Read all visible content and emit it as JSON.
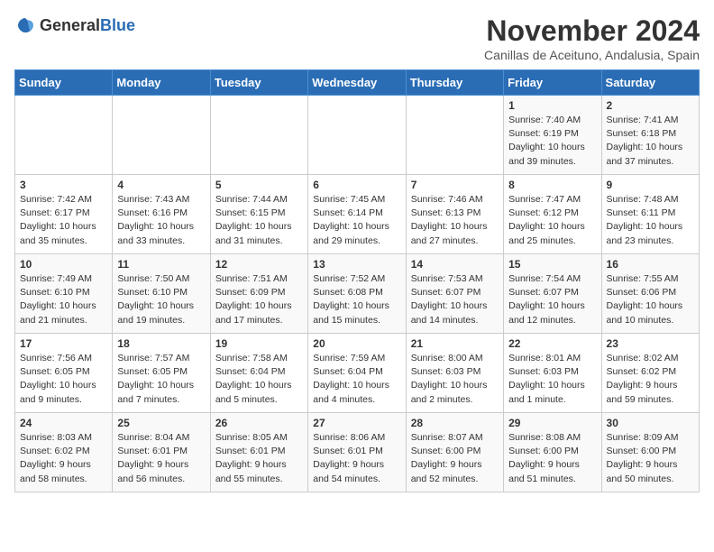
{
  "logo": {
    "text_general": "General",
    "text_blue": "Blue"
  },
  "title": "November 2024",
  "location": "Canillas de Aceituno, Andalusia, Spain",
  "weekdays": [
    "Sunday",
    "Monday",
    "Tuesday",
    "Wednesday",
    "Thursday",
    "Friday",
    "Saturday"
  ],
  "weeks": [
    [
      {
        "day": "",
        "info": ""
      },
      {
        "day": "",
        "info": ""
      },
      {
        "day": "",
        "info": ""
      },
      {
        "day": "",
        "info": ""
      },
      {
        "day": "",
        "info": ""
      },
      {
        "day": "1",
        "info": "Sunrise: 7:40 AM\nSunset: 6:19 PM\nDaylight: 10 hours\nand 39 minutes."
      },
      {
        "day": "2",
        "info": "Sunrise: 7:41 AM\nSunset: 6:18 PM\nDaylight: 10 hours\nand 37 minutes."
      }
    ],
    [
      {
        "day": "3",
        "info": "Sunrise: 7:42 AM\nSunset: 6:17 PM\nDaylight: 10 hours\nand 35 minutes."
      },
      {
        "day": "4",
        "info": "Sunrise: 7:43 AM\nSunset: 6:16 PM\nDaylight: 10 hours\nand 33 minutes."
      },
      {
        "day": "5",
        "info": "Sunrise: 7:44 AM\nSunset: 6:15 PM\nDaylight: 10 hours\nand 31 minutes."
      },
      {
        "day": "6",
        "info": "Sunrise: 7:45 AM\nSunset: 6:14 PM\nDaylight: 10 hours\nand 29 minutes."
      },
      {
        "day": "7",
        "info": "Sunrise: 7:46 AM\nSunset: 6:13 PM\nDaylight: 10 hours\nand 27 minutes."
      },
      {
        "day": "8",
        "info": "Sunrise: 7:47 AM\nSunset: 6:12 PM\nDaylight: 10 hours\nand 25 minutes."
      },
      {
        "day": "9",
        "info": "Sunrise: 7:48 AM\nSunset: 6:11 PM\nDaylight: 10 hours\nand 23 minutes."
      }
    ],
    [
      {
        "day": "10",
        "info": "Sunrise: 7:49 AM\nSunset: 6:10 PM\nDaylight: 10 hours\nand 21 minutes."
      },
      {
        "day": "11",
        "info": "Sunrise: 7:50 AM\nSunset: 6:10 PM\nDaylight: 10 hours\nand 19 minutes."
      },
      {
        "day": "12",
        "info": "Sunrise: 7:51 AM\nSunset: 6:09 PM\nDaylight: 10 hours\nand 17 minutes."
      },
      {
        "day": "13",
        "info": "Sunrise: 7:52 AM\nSunset: 6:08 PM\nDaylight: 10 hours\nand 15 minutes."
      },
      {
        "day": "14",
        "info": "Sunrise: 7:53 AM\nSunset: 6:07 PM\nDaylight: 10 hours\nand 14 minutes."
      },
      {
        "day": "15",
        "info": "Sunrise: 7:54 AM\nSunset: 6:07 PM\nDaylight: 10 hours\nand 12 minutes."
      },
      {
        "day": "16",
        "info": "Sunrise: 7:55 AM\nSunset: 6:06 PM\nDaylight: 10 hours\nand 10 minutes."
      }
    ],
    [
      {
        "day": "17",
        "info": "Sunrise: 7:56 AM\nSunset: 6:05 PM\nDaylight: 10 hours\nand 9 minutes."
      },
      {
        "day": "18",
        "info": "Sunrise: 7:57 AM\nSunset: 6:05 PM\nDaylight: 10 hours\nand 7 minutes."
      },
      {
        "day": "19",
        "info": "Sunrise: 7:58 AM\nSunset: 6:04 PM\nDaylight: 10 hours\nand 5 minutes."
      },
      {
        "day": "20",
        "info": "Sunrise: 7:59 AM\nSunset: 6:04 PM\nDaylight: 10 hours\nand 4 minutes."
      },
      {
        "day": "21",
        "info": "Sunrise: 8:00 AM\nSunset: 6:03 PM\nDaylight: 10 hours\nand 2 minutes."
      },
      {
        "day": "22",
        "info": "Sunrise: 8:01 AM\nSunset: 6:03 PM\nDaylight: 10 hours\nand 1 minute."
      },
      {
        "day": "23",
        "info": "Sunrise: 8:02 AM\nSunset: 6:02 PM\nDaylight: 9 hours\nand 59 minutes."
      }
    ],
    [
      {
        "day": "24",
        "info": "Sunrise: 8:03 AM\nSunset: 6:02 PM\nDaylight: 9 hours\nand 58 minutes."
      },
      {
        "day": "25",
        "info": "Sunrise: 8:04 AM\nSunset: 6:01 PM\nDaylight: 9 hours\nand 56 minutes."
      },
      {
        "day": "26",
        "info": "Sunrise: 8:05 AM\nSunset: 6:01 PM\nDaylight: 9 hours\nand 55 minutes."
      },
      {
        "day": "27",
        "info": "Sunrise: 8:06 AM\nSunset: 6:01 PM\nDaylight: 9 hours\nand 54 minutes."
      },
      {
        "day": "28",
        "info": "Sunrise: 8:07 AM\nSunset: 6:00 PM\nDaylight: 9 hours\nand 52 minutes."
      },
      {
        "day": "29",
        "info": "Sunrise: 8:08 AM\nSunset: 6:00 PM\nDaylight: 9 hours\nand 51 minutes."
      },
      {
        "day": "30",
        "info": "Sunrise: 8:09 AM\nSunset: 6:00 PM\nDaylight: 9 hours\nand 50 minutes."
      }
    ]
  ]
}
